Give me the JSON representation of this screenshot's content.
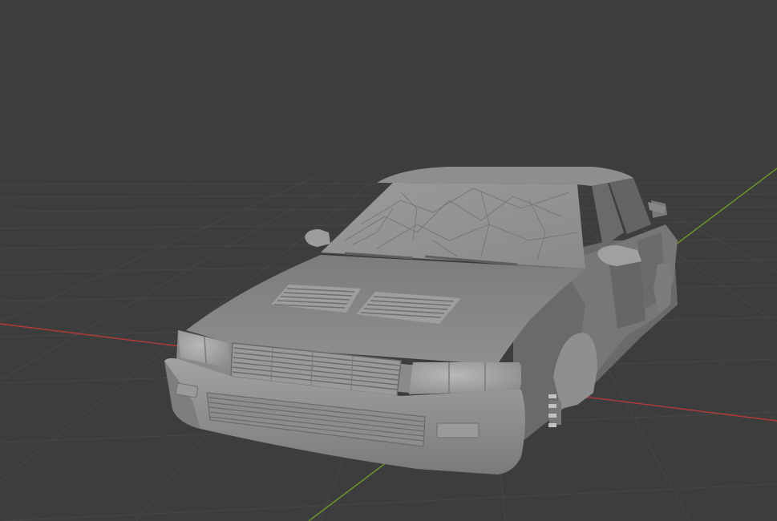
{
  "viewport": {
    "background_color": "#3d3d3d",
    "grid_line_color": "#4a4a4a",
    "x_axis_color": "#b23a3a",
    "y_axis_color": "#6e9a2a",
    "object": {
      "type": "car-body-mesh",
      "shading": "solid",
      "base_color": "#8c8c8c"
    }
  }
}
